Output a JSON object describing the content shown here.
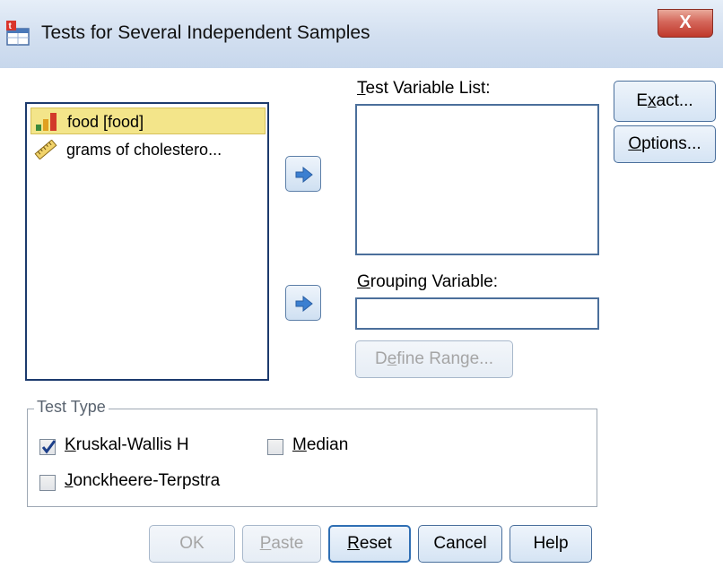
{
  "window": {
    "title": "Tests for Several Independent Samples",
    "close_glyph": "X"
  },
  "variables": [
    {
      "label": "food [food]",
      "icon": "nominal-bar-icon",
      "selected": true
    },
    {
      "label": "grams of cholestero...",
      "icon": "scale-ruler-icon",
      "selected": false
    }
  ],
  "test_variable_list": {
    "label_accel": "T",
    "label_rest": "est Variable List:",
    "items": []
  },
  "grouping_variable": {
    "label_accel": "G",
    "label_rest": "rouping Variable:",
    "value": ""
  },
  "define_range": {
    "label_pre": "D",
    "label_accel": "e",
    "label_rest": "fine Range...",
    "enabled": false
  },
  "side_buttons": {
    "exact": {
      "pre": "E",
      "accel": "x",
      "rest": "act..."
    },
    "options": {
      "accel": "O",
      "rest": "ptions..."
    }
  },
  "test_type": {
    "legend": "Test Type",
    "kruskal": {
      "accel": "K",
      "rest": "ruskal-Wallis H",
      "checked": true
    },
    "median": {
      "accel": "M",
      "rest": "edian",
      "checked": false
    },
    "jonckheere": {
      "accel": "J",
      "rest": "onckheere-Terpstra",
      "checked": false
    }
  },
  "bottom_buttons": {
    "ok": {
      "label": "OK",
      "enabled": false
    },
    "paste": {
      "accel": "P",
      "rest": "aste",
      "enabled": false
    },
    "reset": {
      "accel": "R",
      "rest": "eset",
      "enabled": true
    },
    "cancel": {
      "label": "Cancel",
      "enabled": true
    },
    "help": {
      "label": "Help",
      "enabled": true
    }
  },
  "colors": {
    "titlebar": "#d2dff0",
    "selection": "#f3e58a",
    "arrow": "#3b7fd1",
    "close": "#c0392b"
  }
}
